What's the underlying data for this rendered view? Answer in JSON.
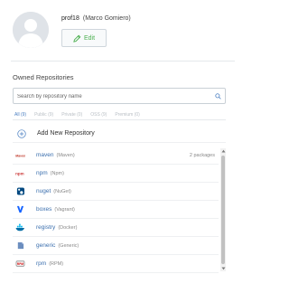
{
  "profile": {
    "username": "prof18",
    "full_name": "(Marco Gomiero)",
    "edit_label": "Edit"
  },
  "repositories": {
    "section_title": "Owned Repositories",
    "search_placeholder": "Search by repository name",
    "tabs": [
      {
        "label": "All (9)",
        "active": true
      },
      {
        "label": "Public (9)",
        "active": false
      },
      {
        "label": "Private (0)",
        "active": false
      },
      {
        "label": "OSS (9)",
        "active": false
      },
      {
        "label": "Premium (0)",
        "active": false
      }
    ],
    "add_label": "Add New Repository",
    "items": [
      {
        "name": "maven",
        "kind": "(Maven)",
        "count": "2 packages",
        "logo": "maven-icon"
      },
      {
        "name": "npm",
        "kind": "(Npm)",
        "count": "",
        "logo": "npm-icon"
      },
      {
        "name": "nuget",
        "kind": "(NuGet)",
        "count": "",
        "logo": "nuget-icon"
      },
      {
        "name": "boxes",
        "kind": "(Vagrant)",
        "count": "",
        "logo": "vagrant-icon"
      },
      {
        "name": "registry",
        "kind": "(Docker)",
        "count": "",
        "logo": "docker-icon"
      },
      {
        "name": "generic",
        "kind": "(Generic)",
        "count": "",
        "logo": "generic-icon"
      },
      {
        "name": "rpm",
        "kind": "(RPM)",
        "count": "",
        "logo": "rpm-icon"
      }
    ]
  },
  "colors": {
    "accent": "#4a7fc1",
    "edit_green": "#4caf50",
    "link_blue": "#3b6fae"
  }
}
